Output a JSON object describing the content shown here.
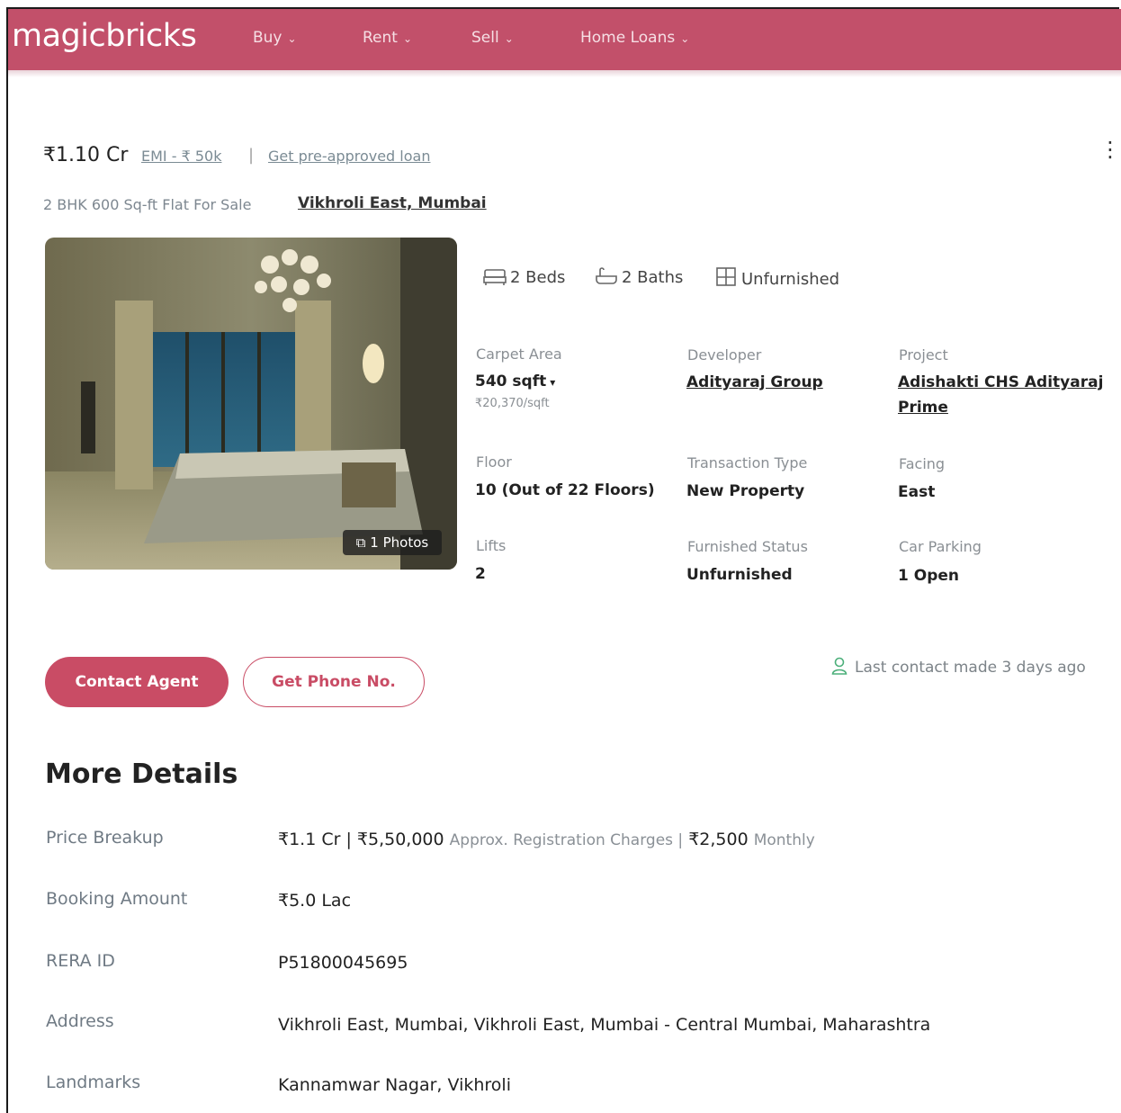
{
  "brand": {
    "logo": "magicbricks"
  },
  "nav": {
    "items": [
      {
        "label": "Buy"
      },
      {
        "label": "Rent"
      },
      {
        "label": "Sell"
      },
      {
        "label": "Home Loans"
      }
    ]
  },
  "listing": {
    "price": "₹1.10 Cr",
    "emi": "EMI - ₹ 50k",
    "separator": "|",
    "loan_link": "Get pre-approved loan",
    "subtitle": "2 BHK 600 Sq-ft Flat For Sale",
    "locality": "Vikhroli East, Mumbai",
    "photo_badge": "1 Photos",
    "amenities": {
      "beds": "2 Beds",
      "baths": "2 Baths",
      "furnishing": "Unfurnished"
    },
    "facts": {
      "carpet_area_label": "Carpet Area",
      "carpet_area_value": "540 sqft",
      "carpet_area_rate": "₹20,370/sqft",
      "developer_label": "Developer",
      "developer_value": "Adityaraj Group",
      "project_label": "Project",
      "project_value_line1": "Adishakti CHS Adityaraj",
      "project_value_line2": "Prime",
      "floor_label": "Floor",
      "floor_value": "10 (Out of 22 Floors)",
      "transaction_label": "Transaction Type",
      "transaction_value": "New Property",
      "facing_label": "Facing",
      "facing_value": "East",
      "lifts_label": "Lifts",
      "lifts_value": "2",
      "furnished_label": "Furnished Status",
      "furnished_value": "Unfurnished",
      "parking_label": "Car Parking",
      "parking_value": "1 Open"
    }
  },
  "actions": {
    "contact_agent": "Contact Agent",
    "get_phone": "Get Phone No.",
    "last_contact": "Last contact made 3 days ago"
  },
  "more_details": {
    "heading": "More Details",
    "price_breakup_label": "Price Breakup",
    "price_breakup_value_main": "₹1.1 Cr | ₹5,50,000",
    "price_breakup_value_note": "Approx. Registration Charges |",
    "price_breakup_value_monthly": "₹2,500",
    "price_breakup_value_suffix": "Monthly",
    "booking_label": "Booking Amount",
    "booking_value": "₹5.0 Lac",
    "rera_label": "RERA ID",
    "rera_value": "P51800045695",
    "address_label": "Address",
    "address_value": "Vikhroli East, Mumbai, Vikhroli East, Mumbai - Central Mumbai, Maharashtra",
    "landmarks_label": "Landmarks",
    "landmarks_value": "Kannamwar Nagar, Vikhroli"
  },
  "colors": {
    "brand": "#c2506a",
    "button": "#c94c65",
    "contact_icon": "#4caf7a"
  }
}
